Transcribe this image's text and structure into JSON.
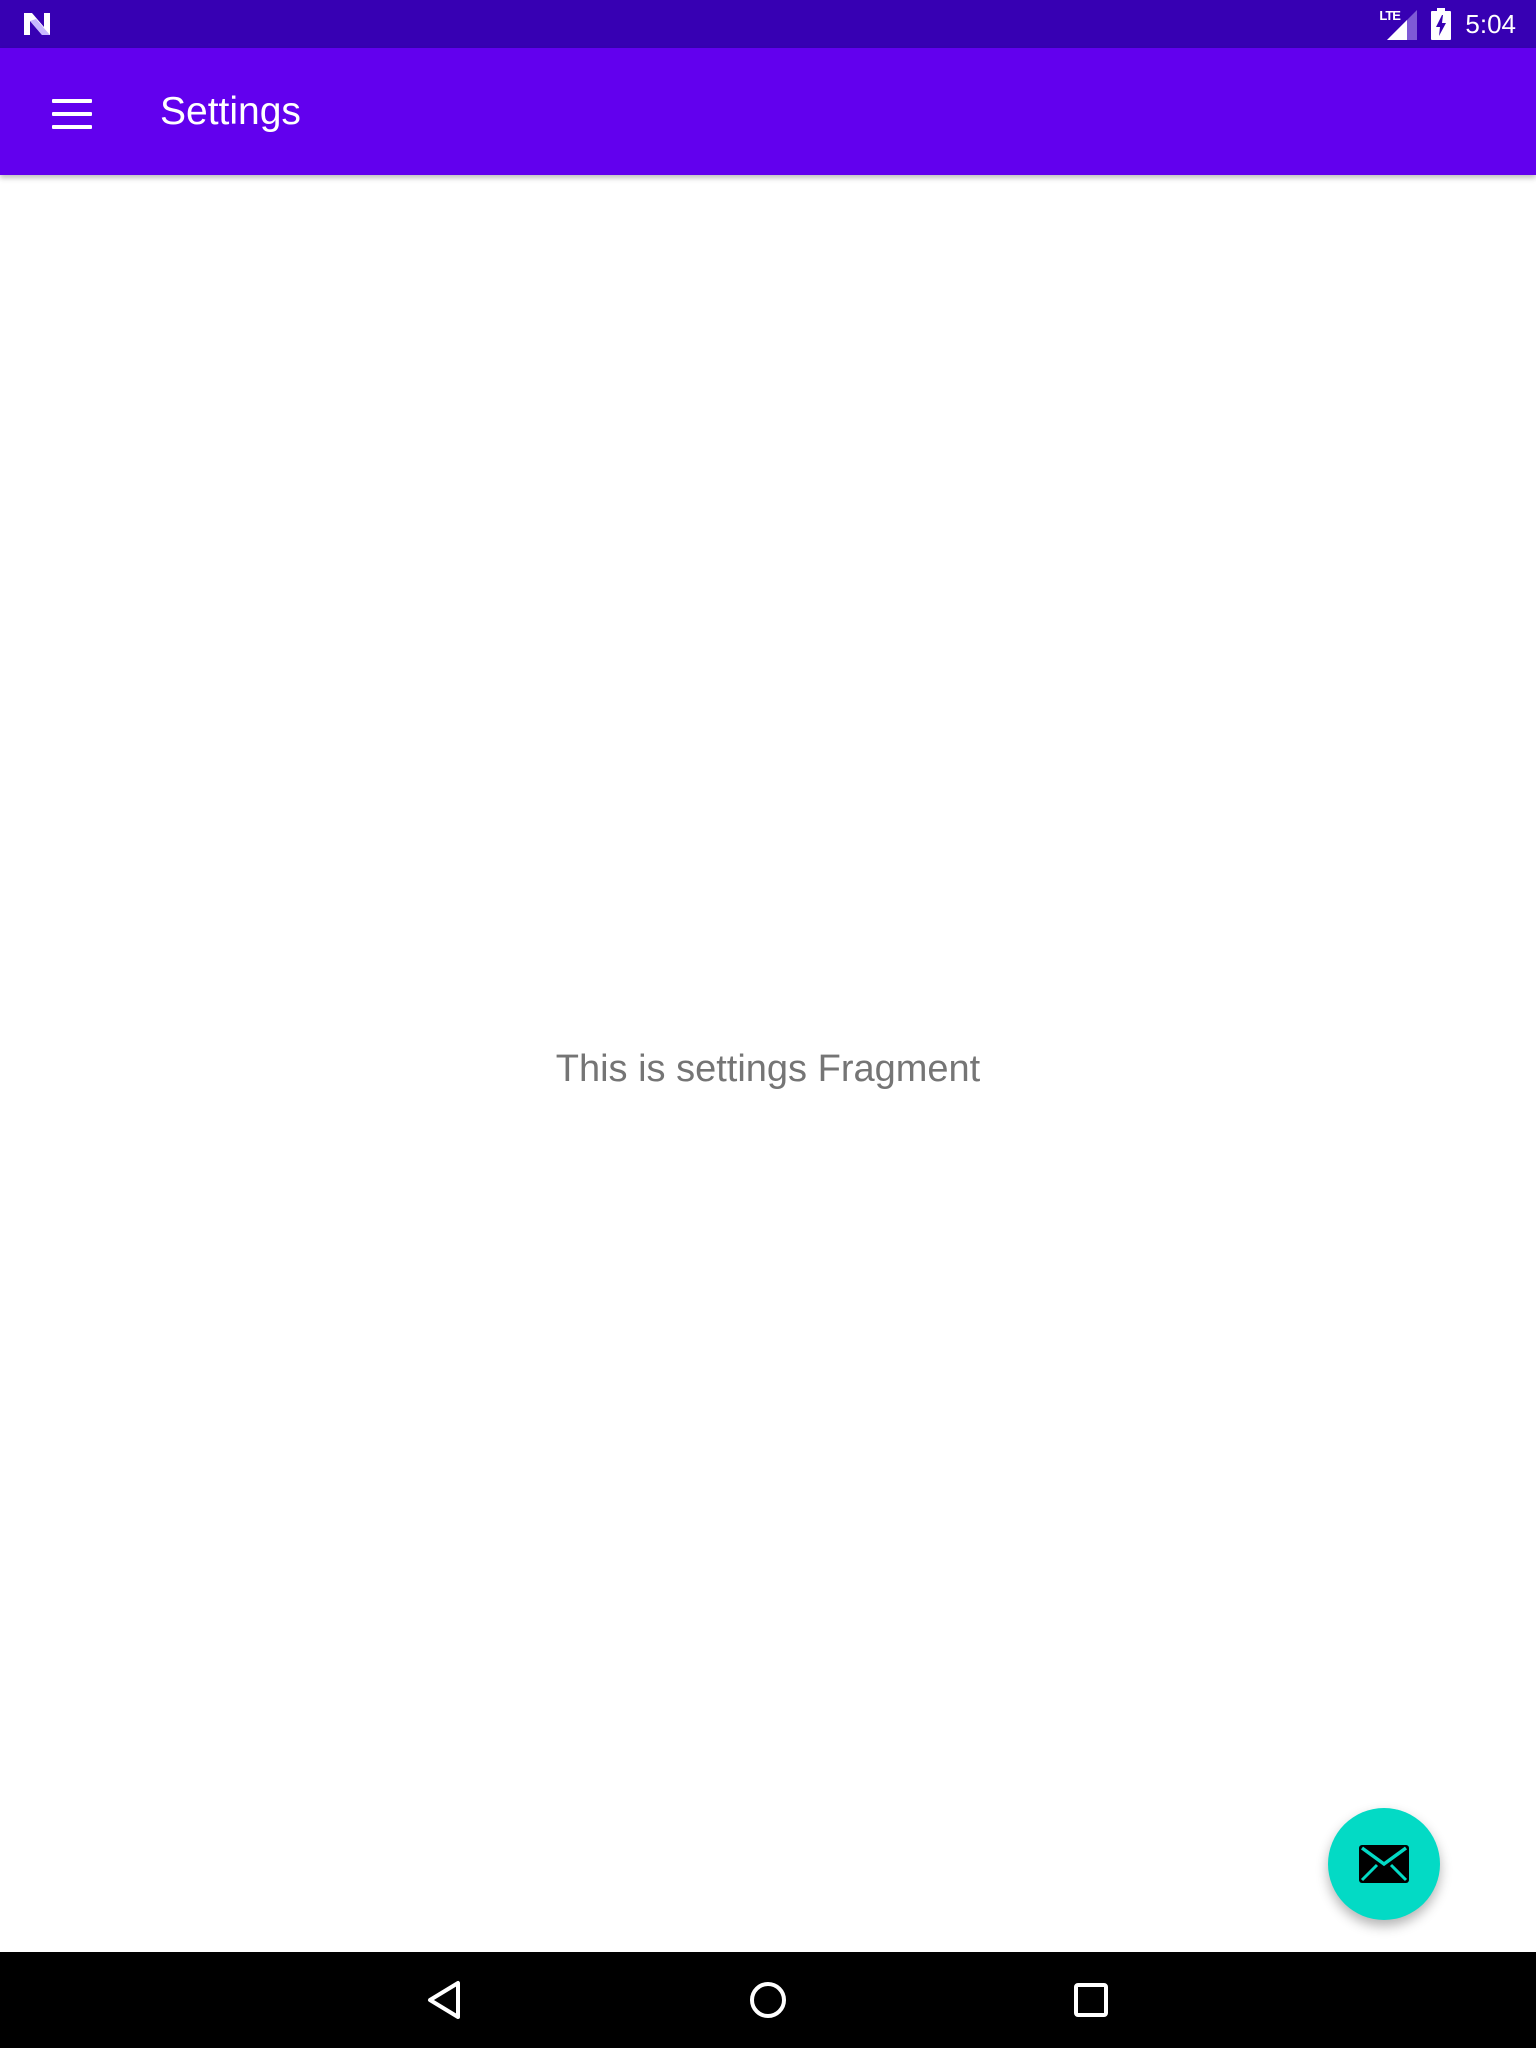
{
  "status_bar": {
    "network_label": "LTE",
    "time": "5:04",
    "icons": [
      "notification-n-icon",
      "signal-icon",
      "battery-charging-icon"
    ]
  },
  "app_bar": {
    "title": "Settings",
    "menu_icon": "hamburger-menu-icon"
  },
  "content": {
    "message": "This is settings Fragment"
  },
  "fab": {
    "icon": "mail-icon"
  },
  "nav_bar": {
    "buttons": [
      "back-icon",
      "home-icon",
      "recents-icon"
    ]
  },
  "colors": {
    "status_bar": "#3700b3",
    "app_bar": "#6200ee",
    "fab": "#03dac5",
    "content_text": "#757575",
    "nav_bar": "#000000"
  }
}
